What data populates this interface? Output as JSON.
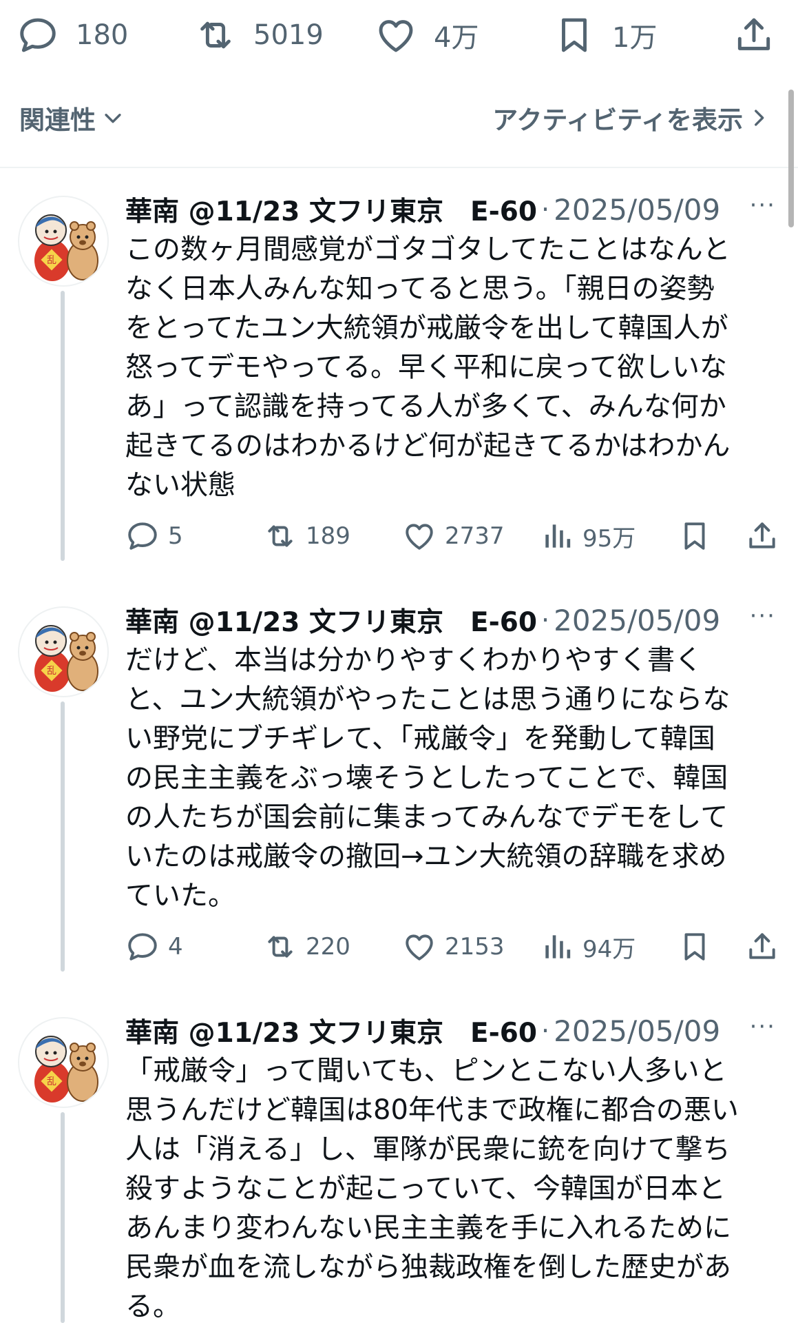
{
  "top_actions": {
    "replies": "180",
    "reposts": "5019",
    "likes": "4万",
    "bookmarks": "1万"
  },
  "sort_bar": {
    "sort_label": "関連性",
    "activity_label": "アクティビティを表示"
  },
  "tweets": [
    {
      "author": "華南 @11/23 文フリ東京　E-60",
      "separator": "·",
      "date": "2025/05/09",
      "more": "···",
      "text": "この数ヶ月間感覚がゴタゴタしてたことはなんと\nなく日本人みんな知ってると思う。「親日の姿勢\nをとってたユン大統領が戒厳令を出して韓国人が\n怒ってデモやってる。早く平和に戻って欲しいな\nあ」って認識を持ってる人が多くて、みんな何か\n起きてるのはわかるけど何が起きてるかはわかん\nない状態",
      "replies": "5",
      "reposts": "189",
      "likes": "2737",
      "views": "95万"
    },
    {
      "author": "華南 @11/23 文フリ東京　E-60",
      "separator": "·",
      "date": "2025/05/09",
      "more": "···",
      "text": "だけど、本当は分かりやすくわかりやすく書く\nと、ユン大統領がやったことは思う通りにならな\nい野党にブチギレて、「戒厳令」を発動して韓国\nの民主主義をぶっ壊そうとしたってことで、韓国\nの人たちが国会前に集まってみんなでデモをして\nいたのは戒厳令の撤回→ユン大統領の辞職を求め\nていた。",
      "replies": "4",
      "reposts": "220",
      "likes": "2153",
      "views": "94万"
    },
    {
      "author": "華南 @11/23 文フリ東京　E-60",
      "separator": "·",
      "date": "2025/05/09",
      "more": "···",
      "text": "「戒厳令」って聞いても、ピンとこない人多いと\n思うんだけど韓国は80年代まで政権に都合の悪い\n人は「消える」し、軍隊が民衆に銃を向けて撃ち\n殺すようなことが起こっていて、今韓国が日本と\nあんまり変わんない民主主義を手に入れるために\n民衆が血を流しながら独裁政権を倒した歴史があ\nる。"
    }
  ],
  "icons": {
    "reply": "reply-icon",
    "repost": "repost-icon",
    "like": "heart-icon",
    "bookmark": "bookmark-icon",
    "share": "share-icon",
    "views": "views-icon",
    "more": "more-icon"
  },
  "colors": {
    "text": "#0f1419",
    "muted": "#536471",
    "divider": "#eff3f4",
    "thread_line": "#d0d7dc"
  }
}
